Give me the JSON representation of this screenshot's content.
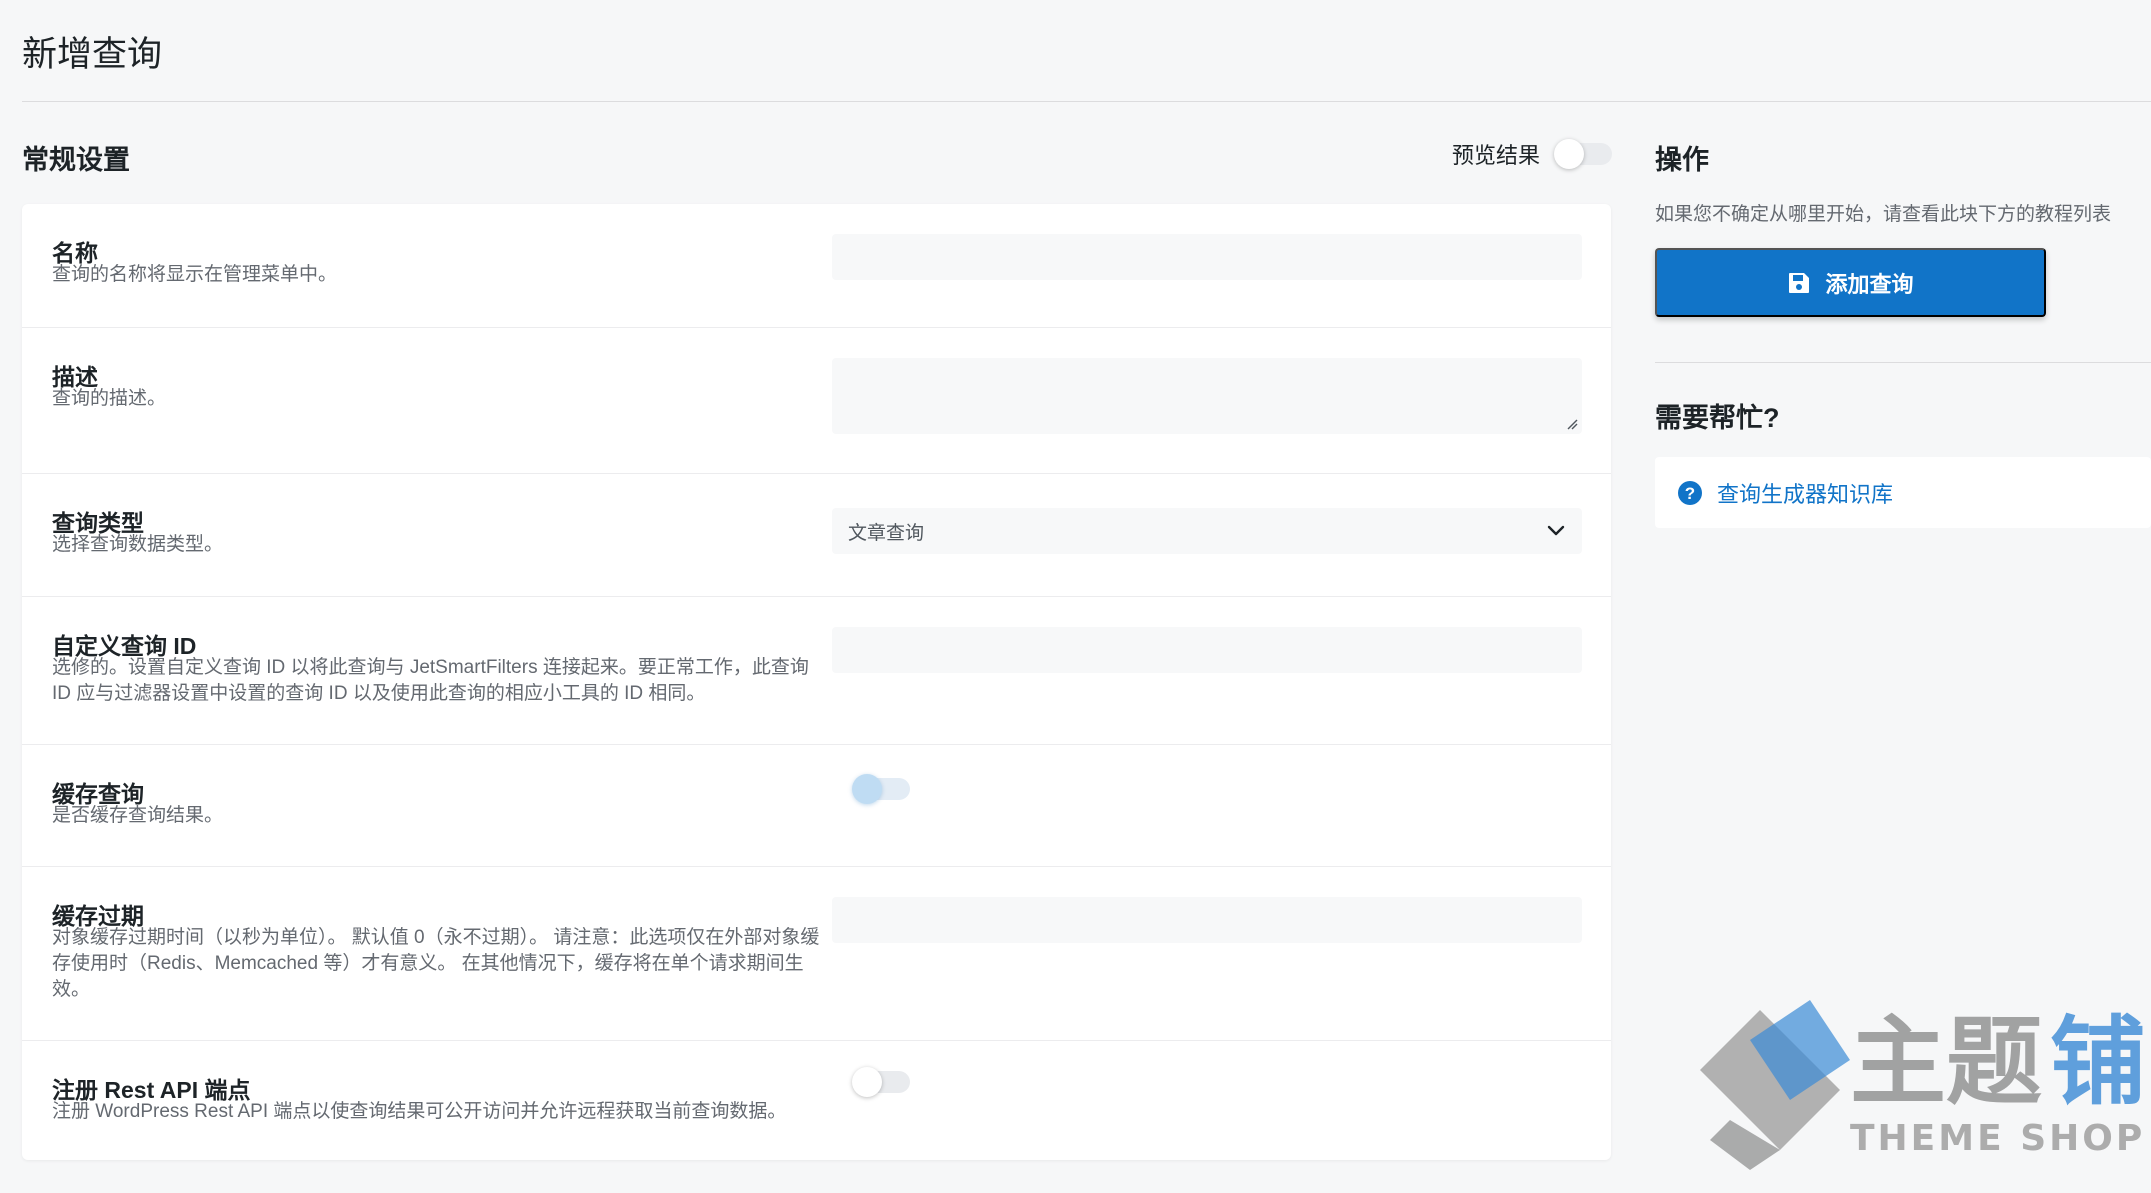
{
  "page": {
    "title": "新增查询"
  },
  "general": {
    "heading": "常规设置",
    "preview_label": "预览结果",
    "preview_enabled": false
  },
  "fields": [
    {
      "key": "name",
      "label": "名称",
      "desc": "查询的名称将显示在管理菜单中。",
      "value": "",
      "type": "text"
    },
    {
      "key": "description",
      "label": "描述",
      "desc": "查询的描述。",
      "value": "",
      "type": "textarea"
    },
    {
      "key": "query_type",
      "label": "查询类型",
      "desc": "选择查询数据类型。",
      "value": "文章查询",
      "type": "select"
    },
    {
      "key": "custom_id",
      "label": "自定义查询 ID",
      "desc": "选修的。设置自定义查询 ID 以将此查询与 JetSmartFilters 连接起来。要正常工作，此查询 ID 应与过滤器设置中设置的查询 ID 以及使用此查询的相应小工具的 ID 相同。",
      "value": "",
      "type": "text"
    },
    {
      "key": "cache_query",
      "label": "缓存查询",
      "desc": "是否缓存查询结果。",
      "enabled": true,
      "type": "toggle"
    },
    {
      "key": "cache_expires",
      "label": "缓存过期",
      "desc": "对象缓存过期时间（以秒为单位）。 默认值 0（永不过期）。 请注意：此选项仅在外部对象缓存使用时（Redis、Memcached 等）才有意义。 在其他情况下，缓存将在单个请求期间生效。",
      "value": "",
      "type": "text"
    },
    {
      "key": "rest_api",
      "label": "注册 Rest API 端点",
      "desc": "注册 WordPress Rest API 端点以使查询结果可公开访问并允许远程获取当前查询数据。",
      "enabled": false,
      "type": "toggle"
    }
  ],
  "sidebar": {
    "actions_heading": "操作",
    "actions_note": "如果您不确定从哪里开始，请查看此块下方的教程列表",
    "add_button_label": "添加查询",
    "add_button_icon": "save-icon",
    "help_heading": "需要帮忙?",
    "help_link_label": "查询生成器知识库",
    "help_link_icon": "question-circle-icon"
  },
  "watermark": {
    "main": "主题铺",
    "sub": "THEME SHOP"
  },
  "colors": {
    "accent": "#1174c8",
    "background": "#f6f7f8",
    "panel": "#ffffff"
  }
}
